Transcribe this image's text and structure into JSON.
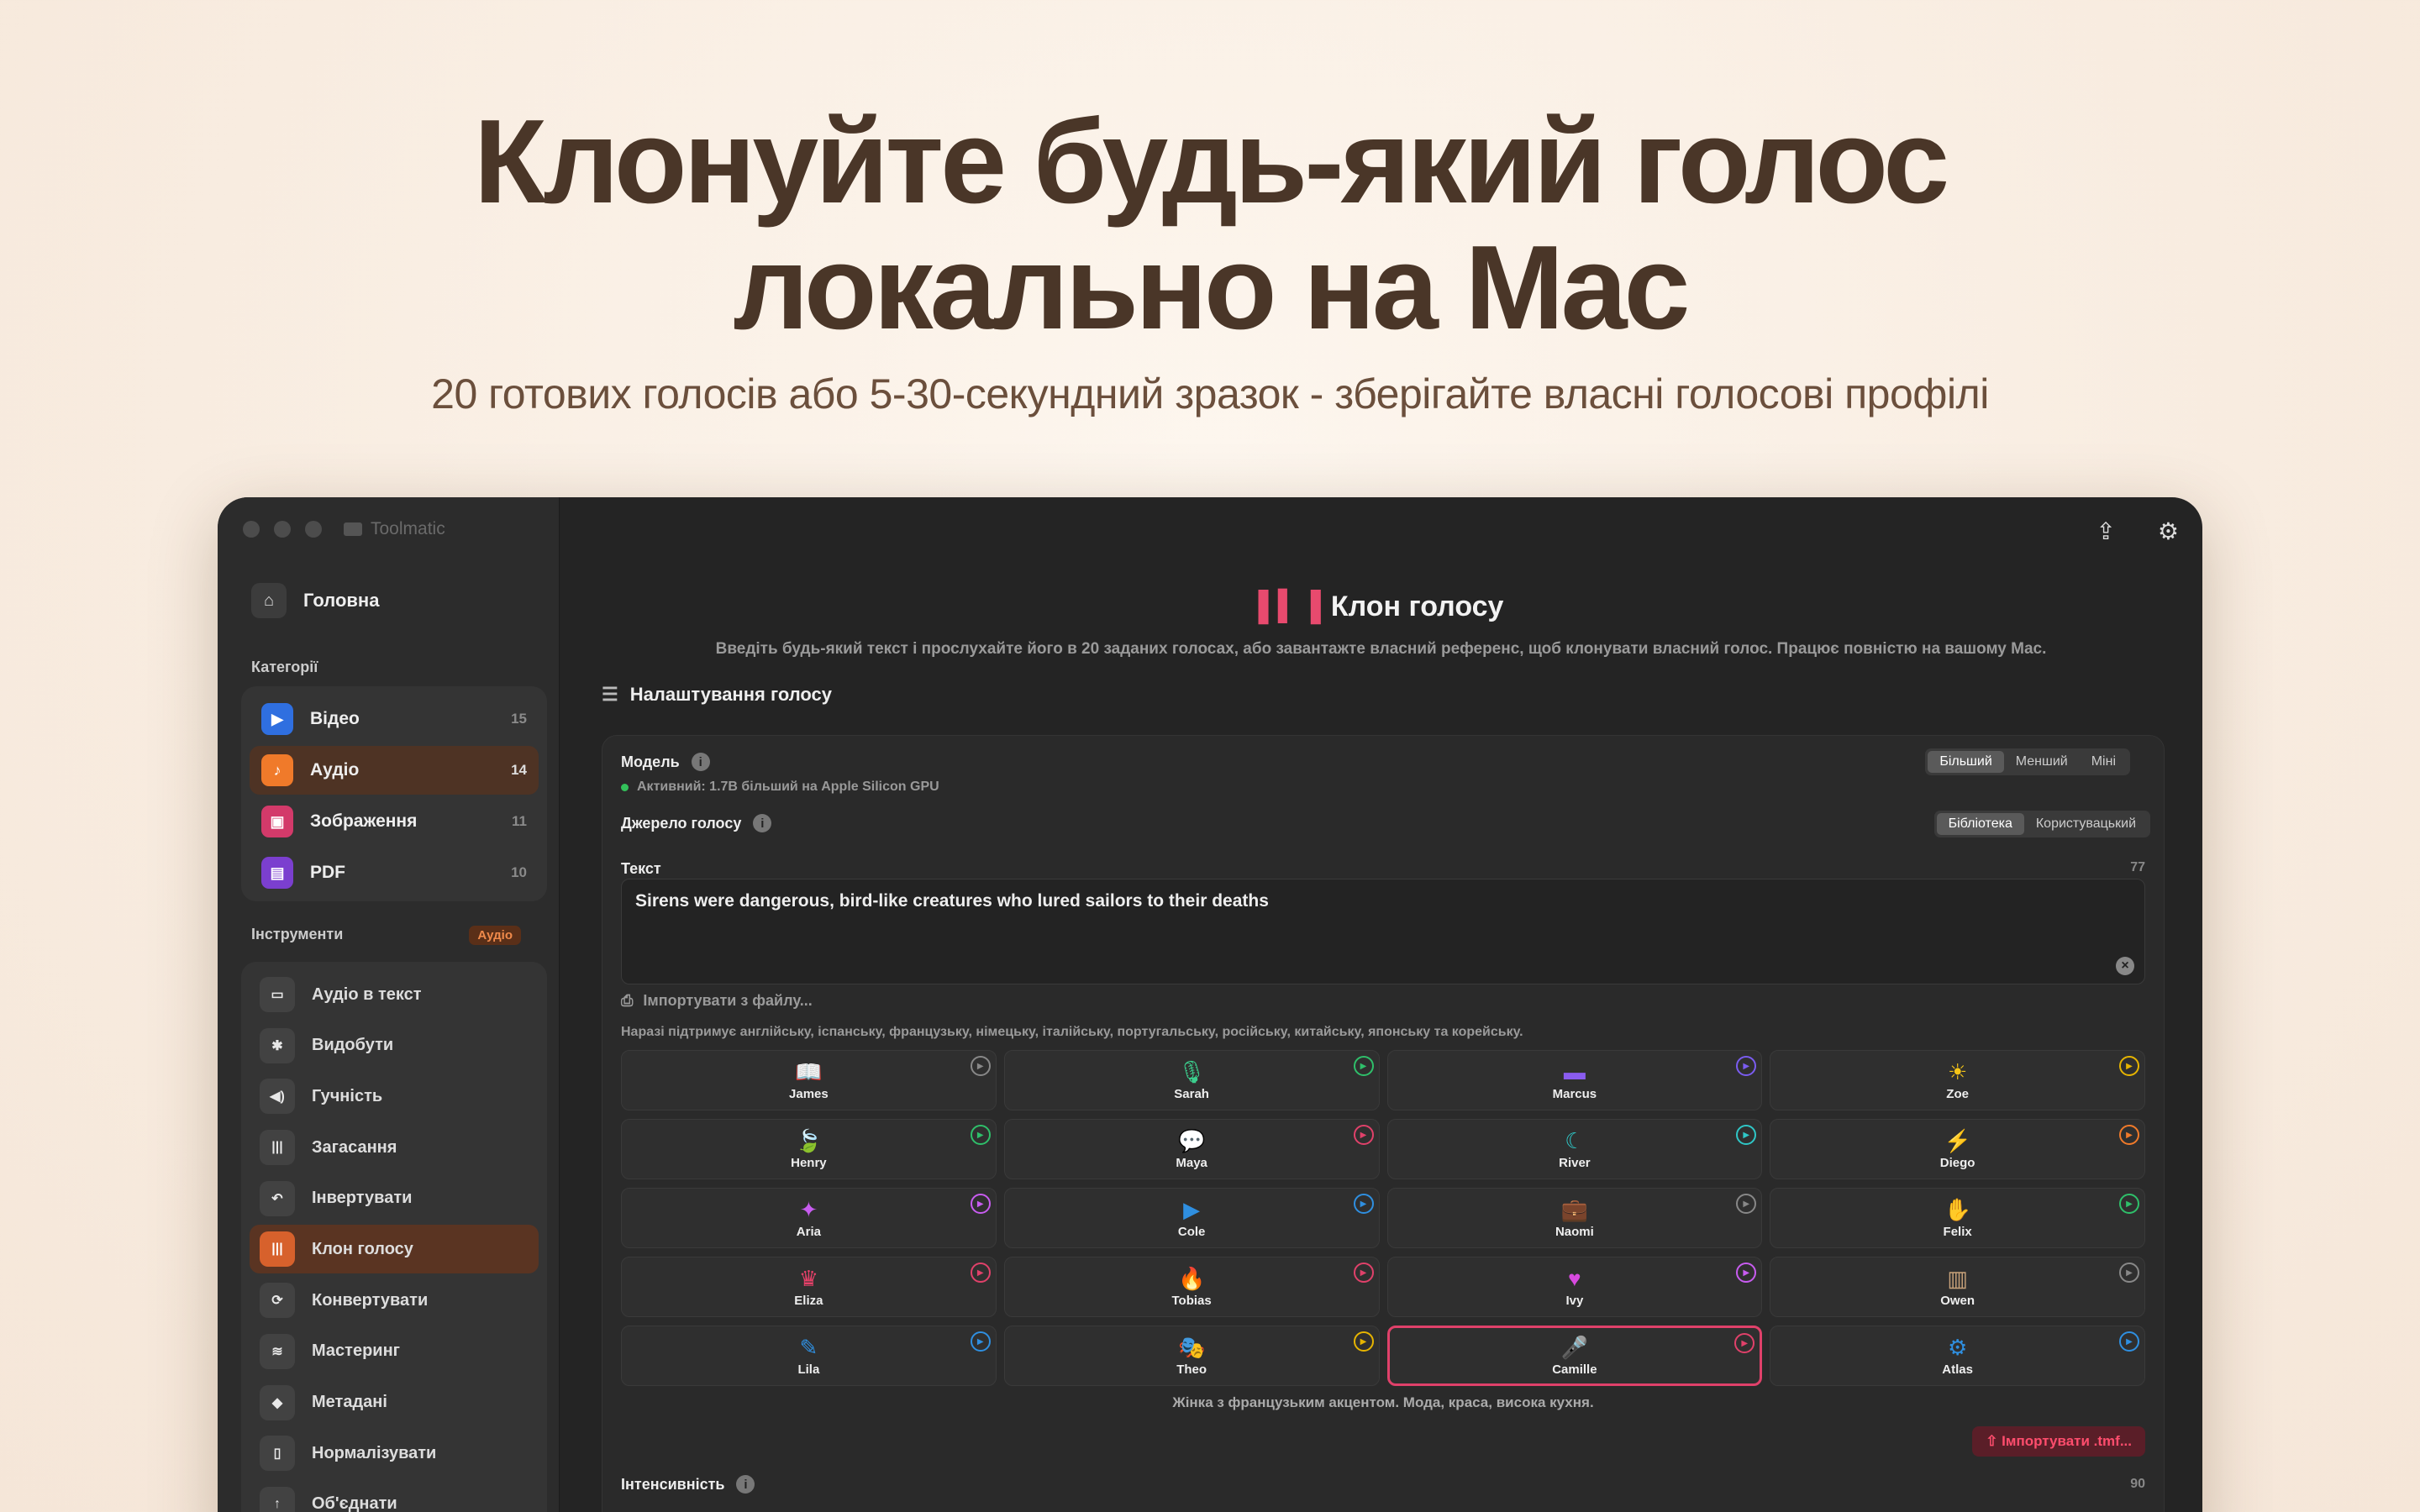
{
  "hero": {
    "title_line1": "Клонуйте будь-який голос",
    "title_line2": "локально на Mac",
    "subtitle": "20 готових голосів або 5-30-секундний зразок - зберігайте власні голосові профілі"
  },
  "window": {
    "app_name": "Toolmatic",
    "home_label": "Головна",
    "categories_label": "Категорії",
    "categories": [
      {
        "label": "Відео",
        "count": "15",
        "color": "#2f6fe0",
        "icon": "video-icon"
      },
      {
        "label": "Аудіо",
        "count": "14",
        "color": "#f07a2a",
        "icon": "music-note-icon"
      },
      {
        "label": "Зображення",
        "count": "11",
        "color": "#d33a6a",
        "icon": "image-icon"
      },
      {
        "label": "PDF",
        "count": "10",
        "color": "#7b3fcf",
        "icon": "document-icon"
      }
    ],
    "tools_label": "Інструменти",
    "tools_tag": "Аудіо",
    "tools": [
      {
        "label": "Аудіо в текст",
        "icon": "chat-bubble-icon"
      },
      {
        "label": "Видобути",
        "icon": "waveform-icon"
      },
      {
        "label": "Гучність",
        "icon": "speaker-icon"
      },
      {
        "label": "Загасання",
        "icon": "fade-icon"
      },
      {
        "label": "Інвертувати",
        "icon": "undo-arrow-icon"
      },
      {
        "label": "Клон голосу",
        "icon": "voice-clone-icon"
      },
      {
        "label": "Конвертувати",
        "icon": "convert-arrows-icon"
      },
      {
        "label": "Мастеринг",
        "icon": "equalizer-icon"
      },
      {
        "label": "Метадані",
        "icon": "tag-icon"
      },
      {
        "label": "Нормалізувати",
        "icon": "normalize-icon"
      },
      {
        "label": "Об'єднати",
        "icon": "merge-icon"
      }
    ]
  },
  "main": {
    "title": "Клон голосу",
    "description": "Введіть будь-який текст і прослухайте його в 20 заданих голосах, або завантажте власний референс, щоб клонувати власний голос. Працює повністю на вашому Mac.",
    "settings_heading": "Налаштування голосу",
    "model_label": "Модель",
    "model_status": "Активний: 1.7B більший на Apple Silicon GPU",
    "model_options": [
      "Більший",
      "Менший",
      "Міні"
    ],
    "source_label": "Джерело голосу",
    "source_options": [
      "Бібліотека",
      "Користувацький"
    ],
    "text_label": "Текст",
    "char_count": "77",
    "text_value": "Sirens were dangerous, bird-like creatures who lured sailors to their deaths",
    "import_file": "Імпортувати з файлу...",
    "support_note": "Наразі підтримує англійську, іспанську, французьку, німецьку, італійську, португальську, російську, китайську, японську та корейську.",
    "voices": [
      {
        "name": "James",
        "glyph": "📖",
        "color": "#d9a36a",
        "play": "#888888"
      },
      {
        "name": "Sarah",
        "glyph": "🎙",
        "color": "#3ccf8e",
        "play": "#2fbf6a"
      },
      {
        "name": "Marcus",
        "glyph": "▬",
        "color": "#8a5cf0",
        "play": "#7a5cf0"
      },
      {
        "name": "Zoe",
        "glyph": "☀",
        "color": "#f5c518",
        "play": "#e6b400"
      },
      {
        "name": "Henry",
        "glyph": "🍃",
        "color": "#2fbf6a",
        "play": "#2fbf6a"
      },
      {
        "name": "Maya",
        "glyph": "💬",
        "color": "#e8416a",
        "play": "#e0416a"
      },
      {
        "name": "River",
        "glyph": "☾",
        "color": "#2fc7c7",
        "play": "#2fc7c7"
      },
      {
        "name": "Diego",
        "glyph": "⚡",
        "color": "#f07a2a",
        "play": "#f07a2a"
      },
      {
        "name": "Aria",
        "glyph": "✦",
        "color": "#c85cf0",
        "play": "#c85cf0"
      },
      {
        "name": "Cole",
        "glyph": "▶",
        "color": "#2f8fe0",
        "play": "#2f8fe0"
      },
      {
        "name": "Naomi",
        "glyph": "💼",
        "color": "#c8a27a",
        "play": "#888888"
      },
      {
        "name": "Felix",
        "glyph": "✋",
        "color": "#2fbf6a",
        "play": "#2fbf6a"
      },
      {
        "name": "Eliza",
        "glyph": "♛",
        "color": "#e8416a",
        "play": "#e0416a"
      },
      {
        "name": "Tobias",
        "glyph": "🔥",
        "color": "#f05a3a",
        "play": "#e0416a"
      },
      {
        "name": "Ivy",
        "glyph": "♥",
        "color": "#d84ae0",
        "play": "#c85cf0"
      },
      {
        "name": "Owen",
        "glyph": "▥",
        "color": "#c8a27a",
        "play": "#888888"
      },
      {
        "name": "Lila",
        "glyph": "✎",
        "color": "#2f8fe0",
        "play": "#2f8fe0"
      },
      {
        "name": "Theo",
        "glyph": "🎭",
        "color": "#f5c518",
        "play": "#e6b400"
      },
      {
        "name": "Camille",
        "glyph": "🎤",
        "color": "#e8416a",
        "play": "#e0416a",
        "selected": true
      },
      {
        "name": "Atlas",
        "glyph": "⚙",
        "color": "#2f8fe0",
        "play": "#2f8fe0"
      }
    ],
    "voice_description": "Жінка з французьким акцентом. Мода, краса, висока кухня.",
    "import_button": "Імпортувати .tmf...",
    "intensity_label": "Інтенсивність",
    "intensity_value": "90"
  }
}
